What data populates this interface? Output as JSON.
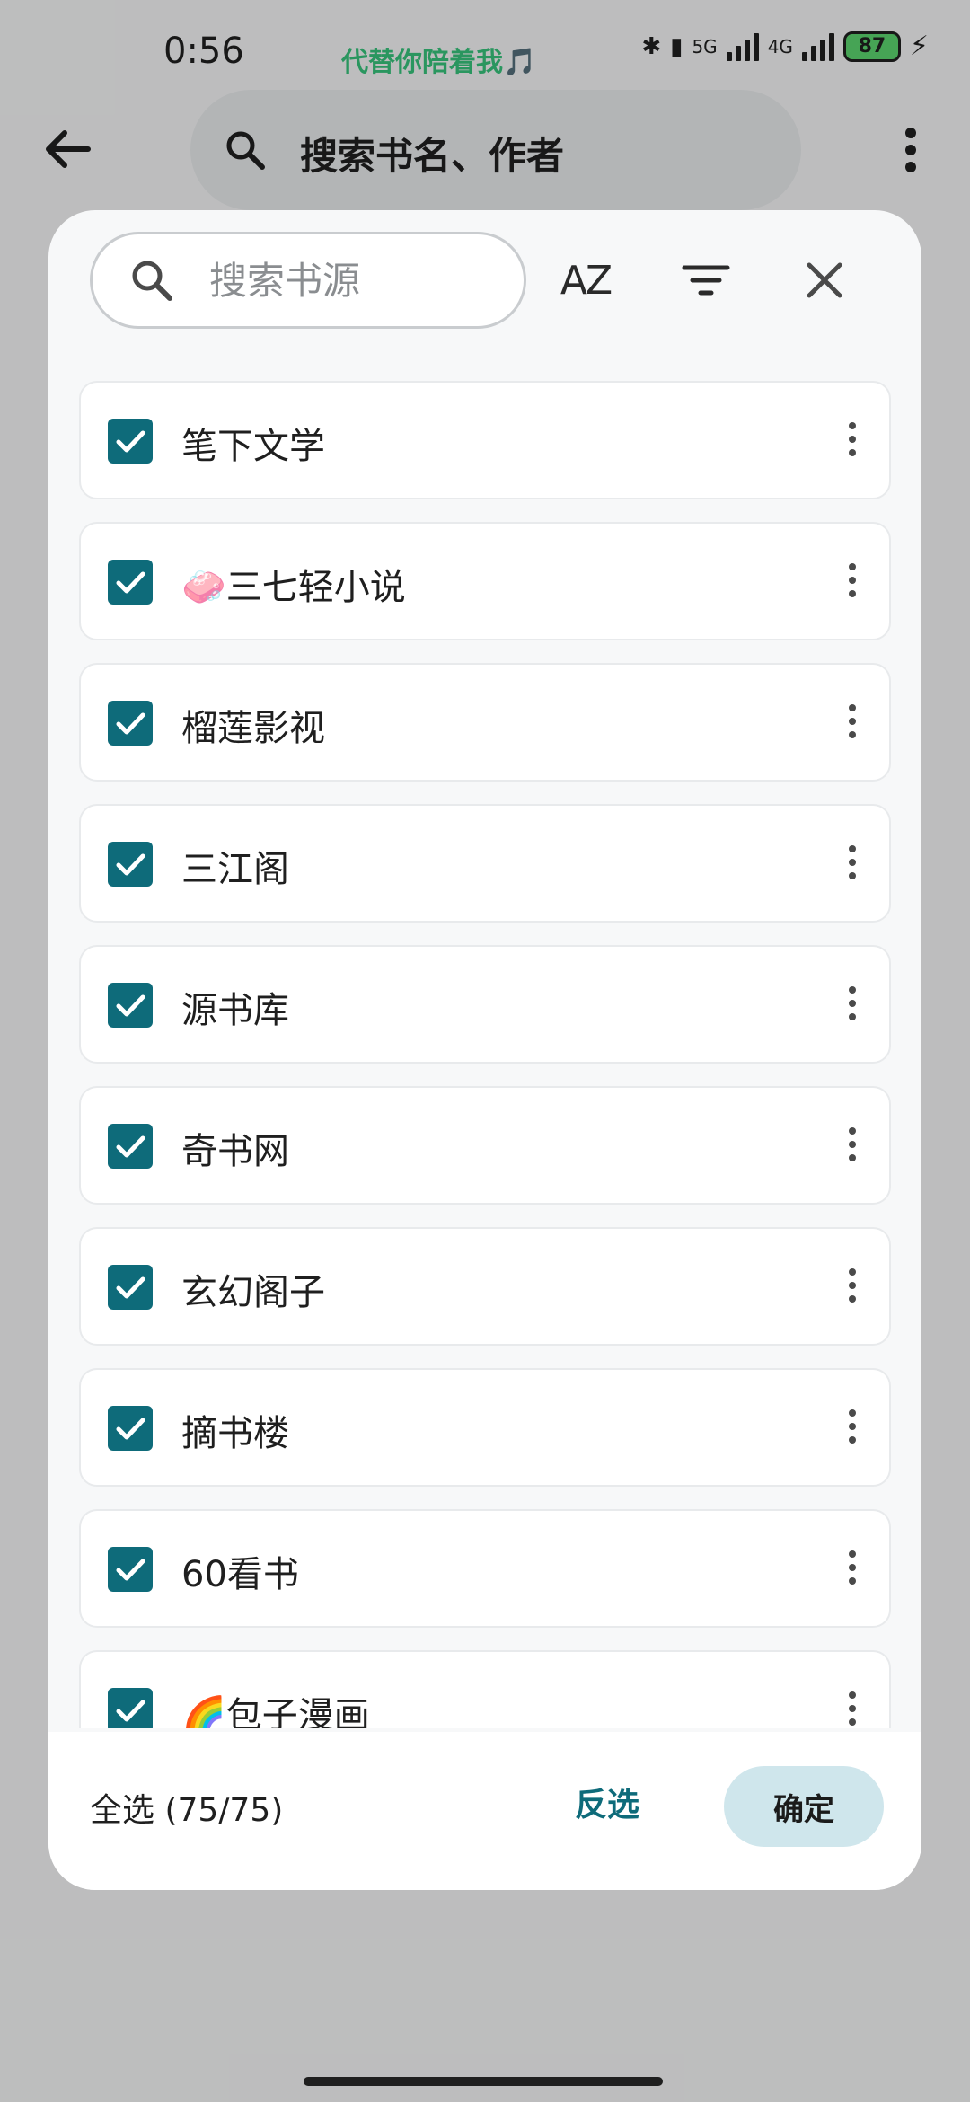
{
  "status_bar": {
    "time": "0:56",
    "marquee": "代替你陪着我🎵",
    "network_5g": "5G",
    "network_4g": "4G",
    "battery": "87"
  },
  "app_bar": {
    "search_placeholder": "搜索书名、作者"
  },
  "dialog": {
    "search_placeholder": "搜索书源",
    "sort_label": "AZ",
    "sources": [
      {
        "label": "笔下文学",
        "checked": true
      },
      {
        "label": "🧼三七轻小说",
        "checked": true
      },
      {
        "label": "榴莲影视",
        "checked": true
      },
      {
        "label": "三江阁",
        "checked": true
      },
      {
        "label": "源书库",
        "checked": true
      },
      {
        "label": "奇书网",
        "checked": true
      },
      {
        "label": "玄幻阁子",
        "checked": true
      },
      {
        "label": "摘书楼",
        "checked": true
      },
      {
        "label": "60看书",
        "checked": true
      },
      {
        "label": "🌈包子漫画",
        "checked": true
      }
    ],
    "select_all_label": "全选 (75/75)",
    "invert_label": "反选",
    "confirm_label": "确定"
  },
  "colors": {
    "accent": "#0e6b7a",
    "confirm_bg": "#cfe6ec"
  }
}
